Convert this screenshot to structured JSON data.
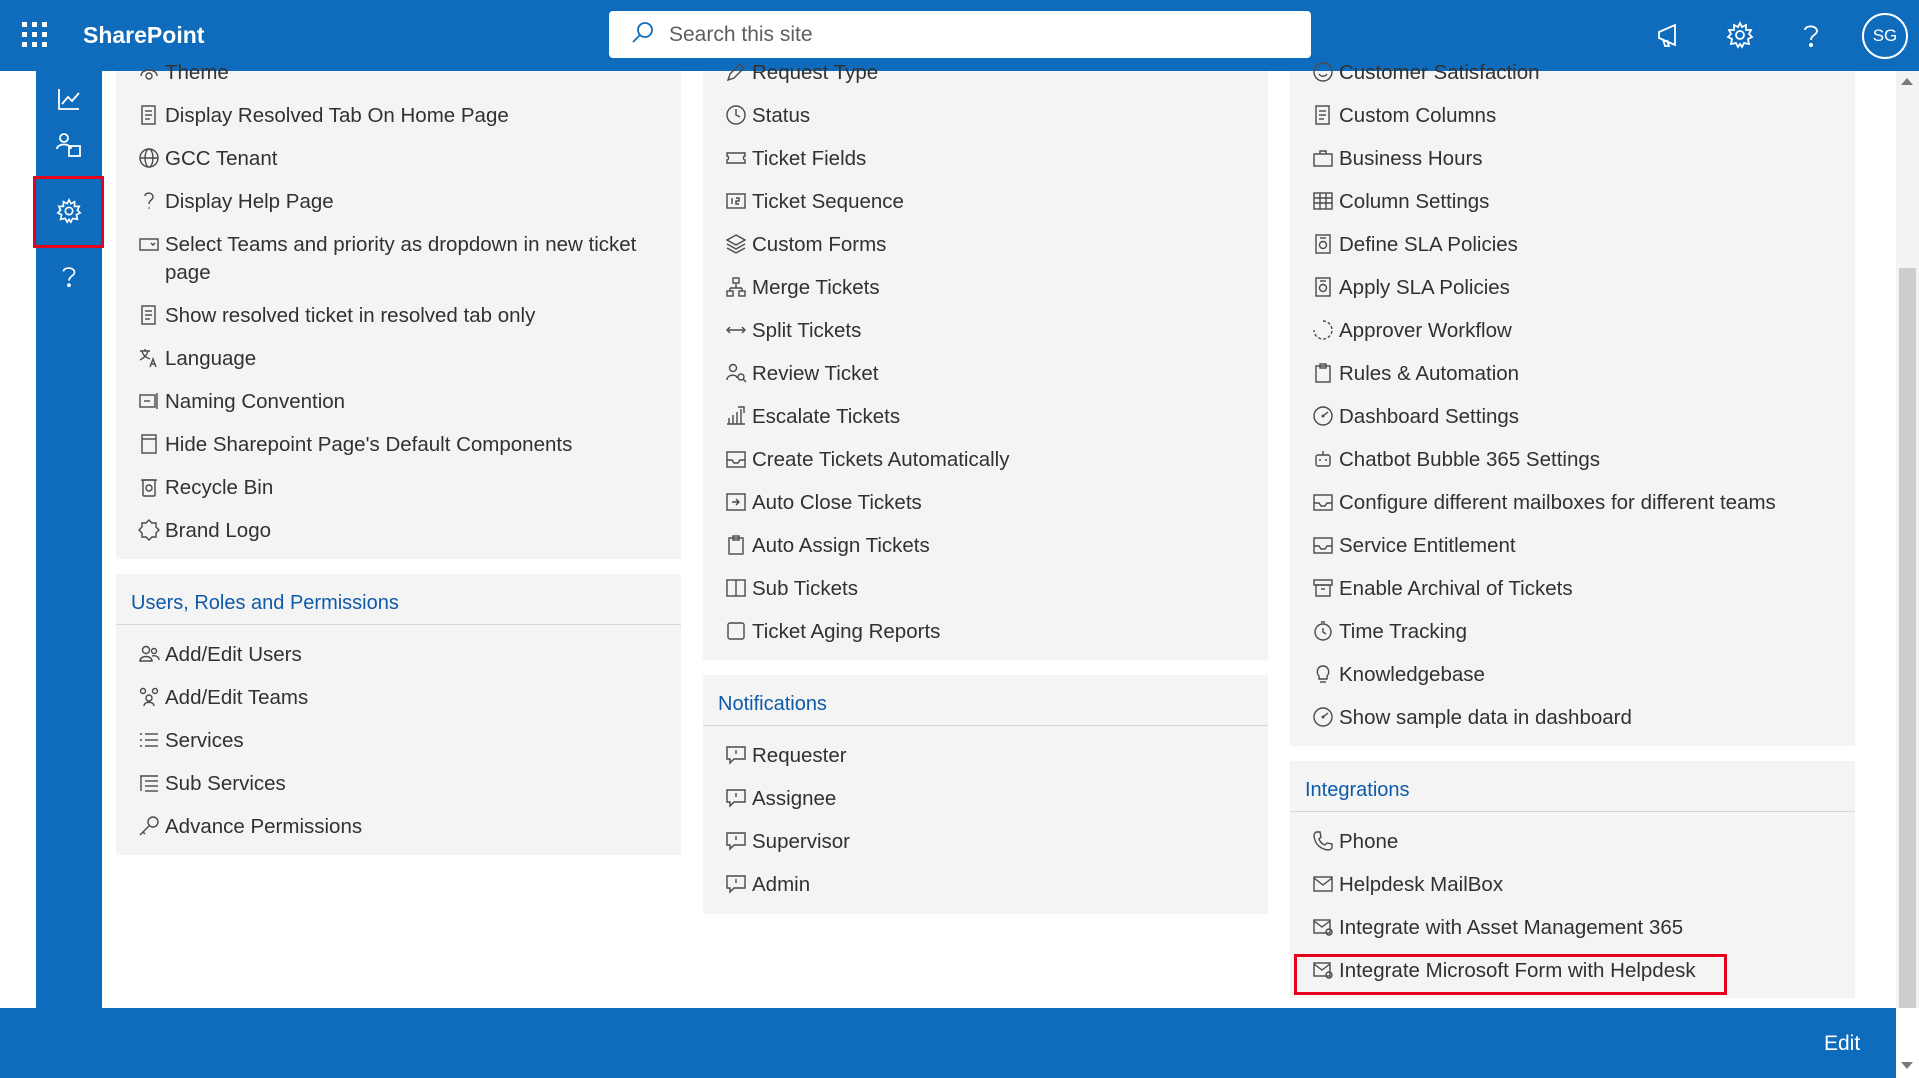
{
  "app": {
    "name": "SharePoint"
  },
  "icons": {
    "waffle": "app-launcher-icon",
    "search": "search-icon",
    "megaphone": "megaphone-icon",
    "settings": "gear-icon",
    "help": "question-icon"
  },
  "search": {
    "placeholder": "Search this site"
  },
  "user": {
    "initials": "SG"
  },
  "rail": {
    "items": [
      {
        "name": "analytics-icon"
      },
      {
        "name": "users-icon"
      },
      {
        "name": "settings-icon",
        "active": true
      },
      {
        "name": "help-icon"
      }
    ]
  },
  "column1": {
    "general_items": [
      {
        "label": "Theme",
        "icon": "theme-icon"
      },
      {
        "label": "Display Resolved Tab On Home Page",
        "icon": "document-icon"
      },
      {
        "label": "GCC Tenant",
        "icon": "globe-icon"
      },
      {
        "label": "Display Help Page",
        "icon": "question-icon"
      },
      {
        "label": "Select Teams and priority as dropdown in new ticket page",
        "icon": "dropdown-icon"
      },
      {
        "label": "Show resolved ticket in resolved tab only",
        "icon": "document-icon"
      },
      {
        "label": "Language",
        "icon": "translate-icon"
      },
      {
        "label": "Naming Convention",
        "icon": "rename-icon"
      },
      {
        "label": "Hide Sharepoint Page's Default Components",
        "icon": "page-icon"
      },
      {
        "label": "Recycle Bin",
        "icon": "recycle-bin-icon"
      },
      {
        "label": "Brand Logo",
        "icon": "badge-icon"
      }
    ],
    "users_section": {
      "title": "Users, Roles and Permissions",
      "items": [
        {
          "label": "Add/Edit Users",
          "icon": "people-icon"
        },
        {
          "label": "Add/Edit Teams",
          "icon": "team-icon"
        },
        {
          "label": "Services",
          "icon": "list-icon"
        },
        {
          "label": "Sub Services",
          "icon": "sublist-icon"
        },
        {
          "label": "Advance Permissions",
          "icon": "key-icon"
        }
      ]
    }
  },
  "column2": {
    "ticket_items": [
      {
        "label": "Request Type",
        "icon": "edit-icon"
      },
      {
        "label": "Status",
        "icon": "clock-icon"
      },
      {
        "label": "Ticket Fields",
        "icon": "ticket-icon"
      },
      {
        "label": "Ticket Sequence",
        "icon": "number-icon"
      },
      {
        "label": "Custom Forms",
        "icon": "layers-icon"
      },
      {
        "label": "Merge Tickets",
        "icon": "merge-icon"
      },
      {
        "label": "Split Tickets",
        "icon": "split-icon"
      },
      {
        "label": "Review Ticket",
        "icon": "review-icon"
      },
      {
        "label": "Escalate Tickets",
        "icon": "escalate-icon"
      },
      {
        "label": "Create Tickets Automatically",
        "icon": "mail-inbox-icon"
      },
      {
        "label": "Auto Close Tickets",
        "icon": "auto-close-icon"
      },
      {
        "label": "Auto Assign Tickets",
        "icon": "clipboard-icon"
      },
      {
        "label": "Sub Tickets",
        "icon": "split-view-icon"
      },
      {
        "label": "Ticket Aging Reports",
        "icon": "checkbox-icon"
      }
    ],
    "notifications_section": {
      "title": "Notifications",
      "items": [
        {
          "label": "Requester",
          "icon": "comment-icon"
        },
        {
          "label": "Assignee",
          "icon": "comment-icon"
        },
        {
          "label": "Supervisor",
          "icon": "comment-icon"
        },
        {
          "label": "Admin",
          "icon": "comment-icon"
        }
      ]
    }
  },
  "column3": {
    "config_items": [
      {
        "label": "Customer Satisfaction",
        "icon": "smile-icon"
      },
      {
        "label": "Custom Columns",
        "icon": "document-icon"
      },
      {
        "label": "Business Hours",
        "icon": "briefcase-icon"
      },
      {
        "label": "Column Settings",
        "icon": "grid-icon"
      },
      {
        "label": "Define SLA Policies",
        "icon": "sla-icon"
      },
      {
        "label": "Apply SLA Policies",
        "icon": "sla-icon"
      },
      {
        "label": "Approver Workflow",
        "icon": "workflow-icon"
      },
      {
        "label": "Rules & Automation",
        "icon": "clipboard-icon"
      },
      {
        "label": "Dashboard Settings",
        "icon": "dashboard-icon"
      },
      {
        "label": "Chatbot Bubble 365 Settings",
        "icon": "bot-icon"
      },
      {
        "label": "Configure different mailboxes for different teams",
        "icon": "mail-inbox-icon"
      },
      {
        "label": "Service Entitlement",
        "icon": "mail-inbox-icon"
      },
      {
        "label": "Enable Archival of Tickets",
        "icon": "archive-icon"
      },
      {
        "label": "Time Tracking",
        "icon": "timer-icon"
      },
      {
        "label": "Knowledgebase",
        "icon": "lightbulb-icon"
      },
      {
        "label": "Show sample data in dashboard",
        "icon": "dashboard-icon"
      }
    ],
    "integrations_section": {
      "title": "Integrations",
      "items": [
        {
          "label": "Phone",
          "icon": "phone-icon"
        },
        {
          "label": "Helpdesk MailBox",
          "icon": "mail-icon"
        },
        {
          "label": "Integrate with Asset Management 365",
          "icon": "mail-settings-icon"
        },
        {
          "label": "Integrate Microsoft Form with Helpdesk",
          "icon": "mail-settings-icon",
          "highlighted": true
        }
      ]
    }
  },
  "footer": {
    "edit_label": "Edit"
  },
  "colors": {
    "brand": "#0f6cbd",
    "panel": "#f4f4f4",
    "section_title": "#0f5aa8",
    "highlight": "#e5001b"
  }
}
